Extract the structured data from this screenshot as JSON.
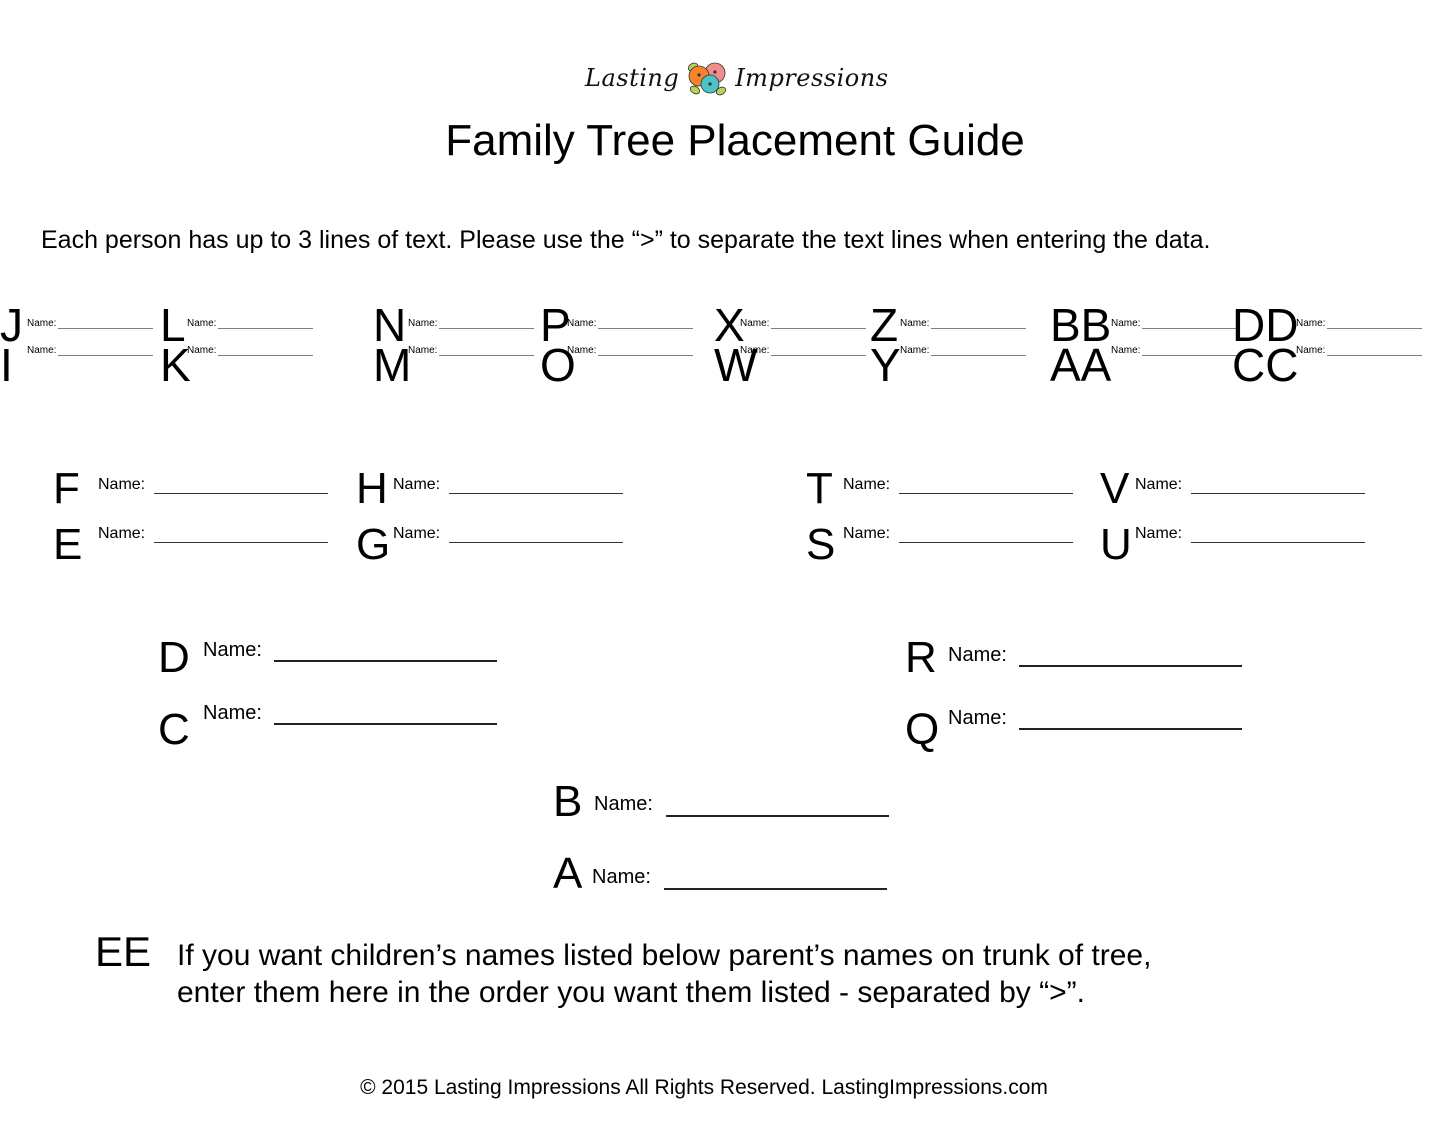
{
  "header": {
    "logo": {
      "brand_left": "Lasting",
      "brand_right": "Impressions",
      "icon": "flower-cluster-icon",
      "flower_colors": {
        "orange": "#f7842a",
        "pink": "#f48c8c",
        "teal": "#4cc3c6",
        "leaf": "#b7d45a"
      }
    },
    "title": "Family Tree Placement Guide",
    "instruction": "Each person has up to 3 lines of text.  Please use the “>” to separate the text lines when entering the data."
  },
  "name_label": "Name:",
  "great_grandparents": [
    {
      "top": "J",
      "bottom": "I"
    },
    {
      "top": "L",
      "bottom": "K"
    },
    {
      "top": "N",
      "bottom": "M"
    },
    {
      "top": "P",
      "bottom": "O"
    },
    {
      "top": "X",
      "bottom": "W"
    },
    {
      "top": "Z",
      "bottom": "Y"
    },
    {
      "top": "BB",
      "bottom": "AA"
    },
    {
      "top": "DD",
      "bottom": "CC"
    }
  ],
  "grandparents": [
    {
      "top": "F",
      "bottom": "E"
    },
    {
      "top": "H",
      "bottom": "G"
    },
    {
      "top": "T",
      "bottom": "S"
    },
    {
      "top": "V",
      "bottom": "U"
    }
  ],
  "parents": [
    {
      "top": "D",
      "bottom": "C"
    },
    {
      "top": "R",
      "bottom": "Q"
    }
  ],
  "couple": {
    "top": "B",
    "bottom": "A"
  },
  "children": {
    "letter": "EE",
    "line1": "If you want children’s names listed below parent’s names on trunk of tree,",
    "line2": "enter them here in the order you want them listed - separated by “>”."
  },
  "footer": "© 2015 Lasting Impressions  All Rights Reserved.   LastingImpressions.com"
}
